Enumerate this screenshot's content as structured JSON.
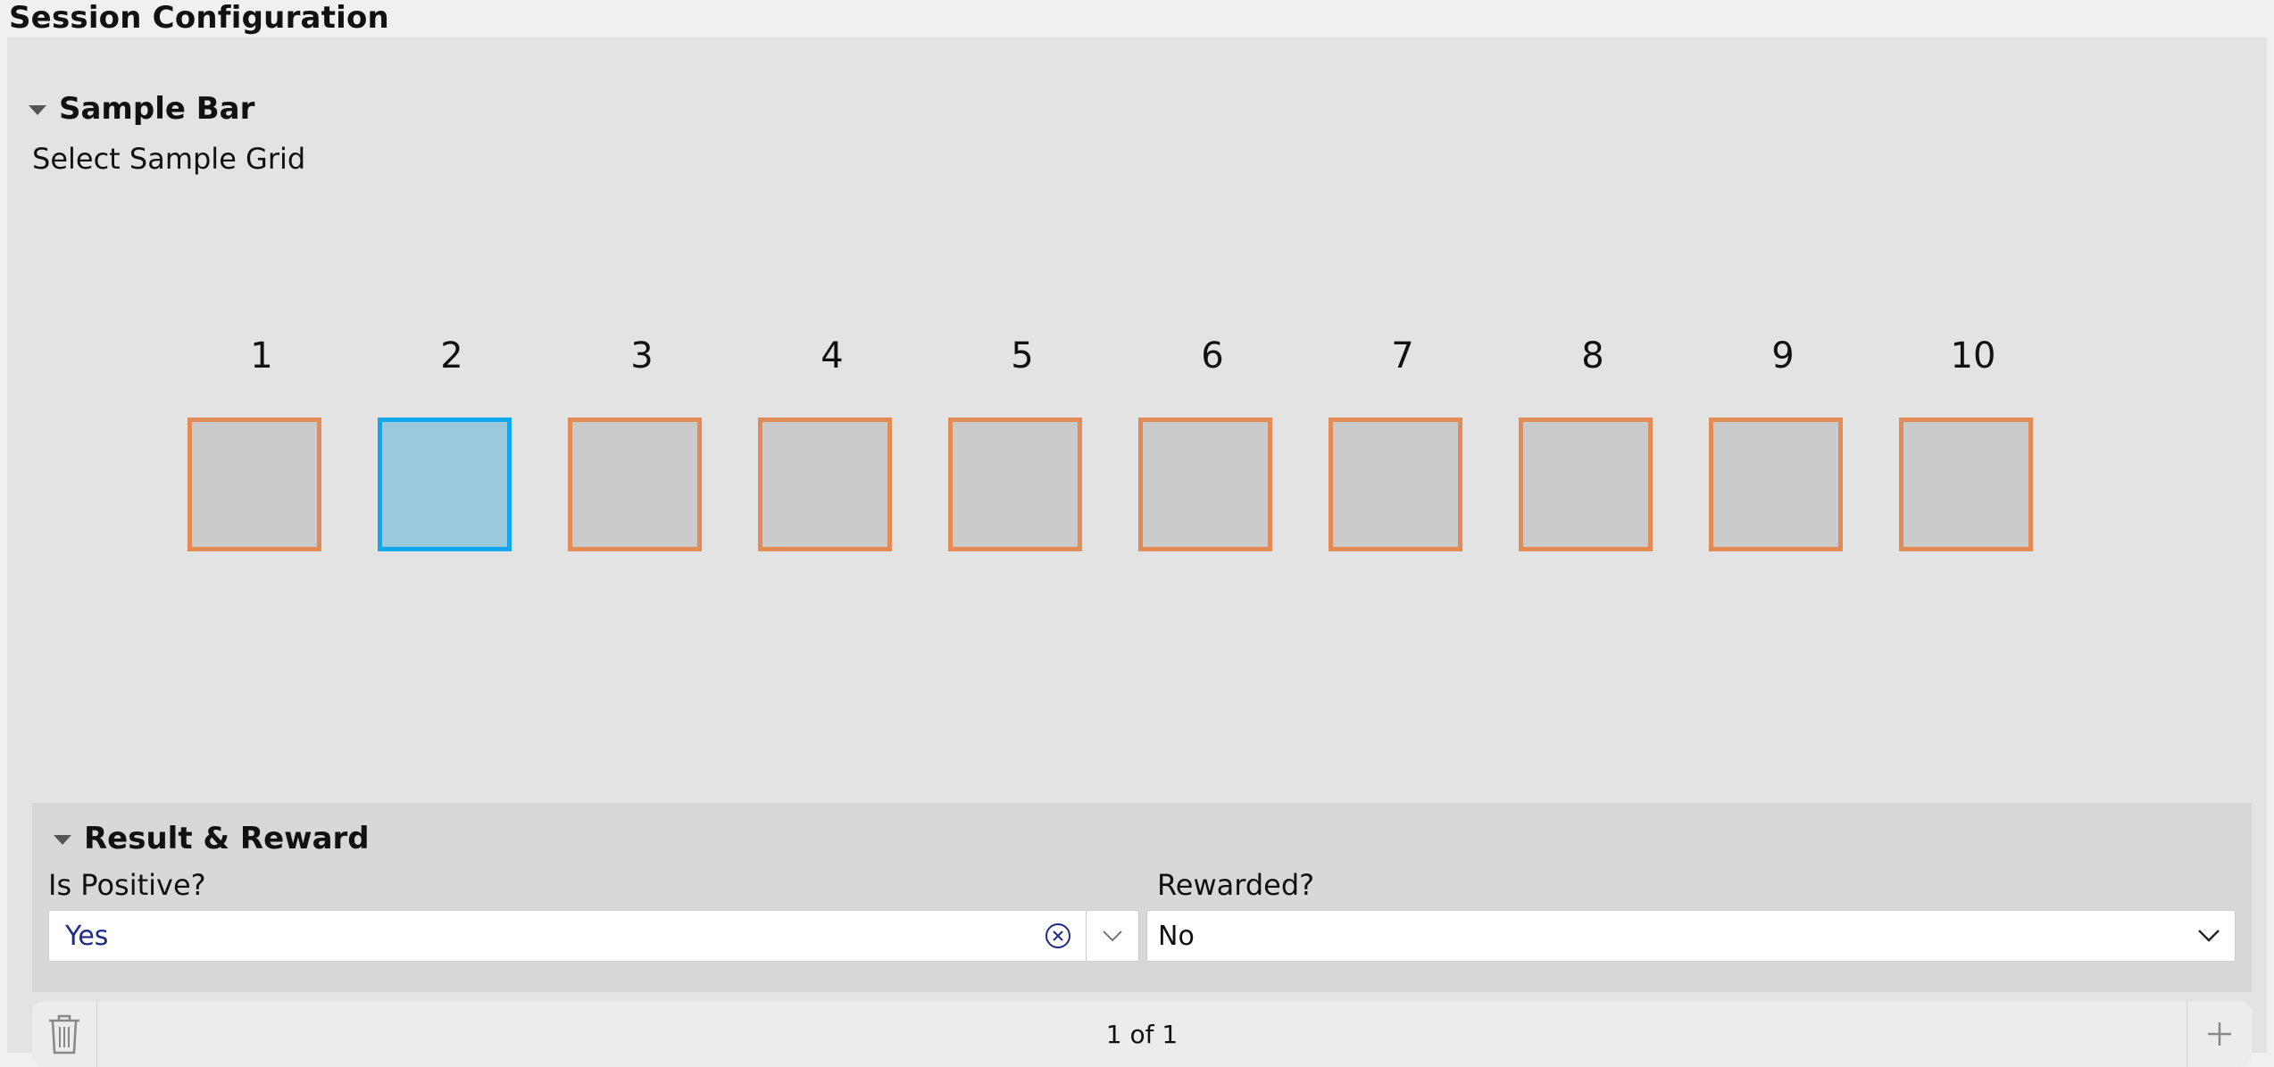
{
  "page": {
    "title": "Session Configuration"
  },
  "sample_bar": {
    "section_title": "Sample Bar",
    "grid_label": "Select Sample Grid",
    "wells": [
      {
        "label": "1",
        "selected": false
      },
      {
        "label": "2",
        "selected": true
      },
      {
        "label": "3",
        "selected": false
      },
      {
        "label": "4",
        "selected": false
      },
      {
        "label": "5",
        "selected": false
      },
      {
        "label": "6",
        "selected": false
      },
      {
        "label": "7",
        "selected": false
      },
      {
        "label": "8",
        "selected": false
      },
      {
        "label": "9",
        "selected": false
      },
      {
        "label": "10",
        "selected": false
      }
    ],
    "colors": {
      "well_fill": "#cbcbcb",
      "well_border": "#e38b55",
      "selected_fill": "#9ac8dc",
      "selected_border": "#12a8f0"
    }
  },
  "result_reward": {
    "section_title": "Result & Reward",
    "is_positive": {
      "label": "Is Positive?",
      "value": "Yes"
    },
    "rewarded": {
      "label": "Rewarded?",
      "value": "No"
    }
  },
  "footer": {
    "pagination": "1 of 1",
    "delete_icon": "trash-icon",
    "add_icon": "plus-icon"
  }
}
